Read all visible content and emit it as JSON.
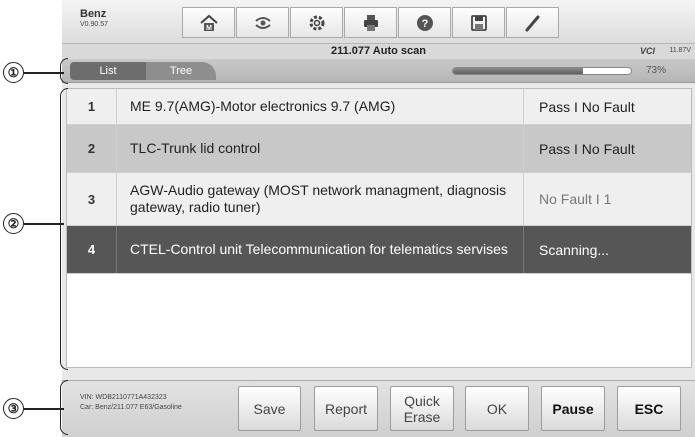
{
  "header": {
    "brand": "Benz",
    "version": "V0.90.57",
    "tools": [
      {
        "name": "home-icon"
      },
      {
        "name": "vehicle-swap-icon"
      },
      {
        "name": "settings-icon"
      },
      {
        "name": "print-icon"
      },
      {
        "name": "help-icon"
      },
      {
        "name": "save-icon"
      },
      {
        "name": "pen-icon"
      }
    ]
  },
  "status": {
    "title": "211.077 Auto scan",
    "vci": "VCI",
    "battery": "11.87V"
  },
  "tabs": [
    {
      "label": "List"
    },
    {
      "label": "Tree"
    }
  ],
  "progress": {
    "value": 73,
    "label": "73%"
  },
  "rows": [
    {
      "num": "1",
      "name": "ME 9.7(AMG)-Motor electronics 9.7 (AMG)",
      "status": "Pass I No Fault"
    },
    {
      "num": "2",
      "name": "TLC-Trunk lid control",
      "status": "Pass I No Fault"
    },
    {
      "num": "3",
      "name": "AGW-Audio gateway (MOST network managment, diagnosis gateway, radio tuner)",
      "status": "No Fault I 1"
    },
    {
      "num": "4",
      "name": "CTEL-Control unit Telecommunication for telematics servises",
      "status": "Scanning..."
    }
  ],
  "footer": {
    "vin": "VIN: WDB2110771A432323",
    "car": "Car: Benz/211.077 E63/Gasoline",
    "buttons": [
      "Save",
      "Report",
      "Quick Erase",
      "OK",
      "Pause",
      "ESC"
    ]
  },
  "callouts": [
    "①",
    "②",
    "③"
  ]
}
